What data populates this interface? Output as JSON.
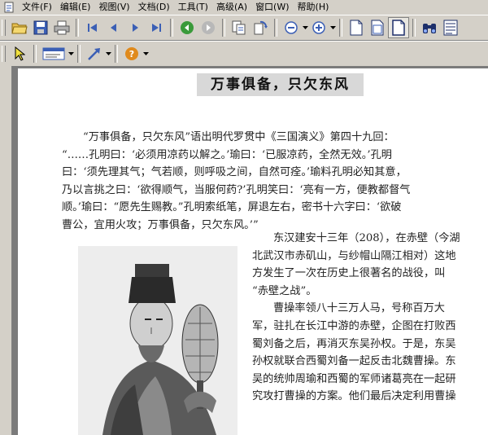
{
  "menu": {
    "items": [
      "文件(F)",
      "编辑(E)",
      "视图(V)",
      "文档(D)",
      "工具(T)",
      "高级(A)",
      "窗口(W)",
      "帮助(H)"
    ]
  },
  "icons": {
    "open": "open-folder-icon",
    "save": "save-disk-icon",
    "print": "printer-icon",
    "first": "first-page-icon",
    "prev": "previous-page-icon",
    "next": "next-page-icon",
    "last": "last-page-icon",
    "back": "go-back-icon",
    "forward": "go-forward-icon",
    "zoom_out": "zoom-out-icon",
    "zoom_in": "zoom-in-icon",
    "select": "select-arrow-icon",
    "help": "help-icon"
  },
  "colors": {
    "chrome": "#d4d0c8",
    "workspace": "#7b7b7b",
    "nav_blue": "#3b5fb5",
    "nav_green": "#3a9a3a",
    "help_orange": "#e08a1c"
  },
  "document": {
    "title": "万事俱备，只欠东风",
    "para1_lines": [
      "“万事俱备，只欠东风”语出明代罗贯中《三国演义》第四十九回：",
      "“……孔明曰：‘必须用凉药以解之。’瑜曰：‘已服凉药，全然无效。’孔明",
      "曰：‘须先理其气；气若顺，则呼吸之间，自然可痊。’瑜料孔明必知其意，",
      "乃以言挑之曰：‘欲得顺气，当服何药?’孔明笑曰：‘亮有一方，便教都督气",
      "顺。’瑜曰：“愿先生赐教。”孔明索纸笔，屏退左右，密书十六字曰：‘欲破",
      "曹公，宜用火攻；万事俱备，只欠东风。’”"
    ],
    "right_lines": [
      "东汉建安十三年（208），在赤壁（今湖",
      "北武汉市赤矶山，与纱帽山隔江相对）这地",
      "方发生了一次在历史上很著名的战役，叫",
      "“赤壁之战”。",
      "曹操率领八十三万人马，号称百万大",
      "军，驻扎在长江中游的赤壁，企图在打败西",
      "蜀刘备之后，再消灭东吴孙权。于是，东吴",
      "孙权就联合西蜀刘备一起反击北魏曹操。东",
      "吴的统帅周瑜和西蜀的军师诸葛亮在一起研",
      "究攻打曹操的方案。他们最后决定利用曹操"
    ]
  }
}
